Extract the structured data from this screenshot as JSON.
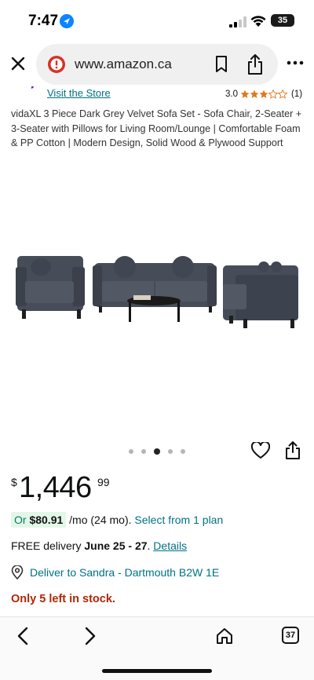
{
  "status_bar": {
    "time": "7:47",
    "battery": "35"
  },
  "browser": {
    "url": "www.amazon.ca",
    "tab_count": "37"
  },
  "store": {
    "link_label": "Visit the Store",
    "rating": "3.0",
    "rating_value": 3,
    "rating_count": "(1)"
  },
  "product": {
    "title": "vidaXL 3 Piece Dark Grey Velvet Sofa Set - Sofa Chair, 2-Seater + 3-Seater with Pillows for Living Room/Lounge | Comfortable Foam & PP Cotton | Modern Design, Solid Wood & Plywood Support",
    "image_count": 5,
    "active_image": 3
  },
  "price": {
    "symbol": "$",
    "whole": "1,446",
    "fraction": "99"
  },
  "financing": {
    "prefix": "Or ",
    "amount": "$80.91",
    "suffix": " /mo (24 mo). ",
    "link": "Select from 1 plan"
  },
  "delivery": {
    "prefix": "FREE delivery ",
    "date": "June 25 - 27",
    "suffix": ". ",
    "link": "Details"
  },
  "deliver_to": {
    "label": "Deliver to Sandra - Dartmouth B2W 1E"
  },
  "stock": {
    "label": "Only 5 left in stock."
  },
  "colors": {
    "link": "#007185",
    "stock": "#b12704",
    "emi_badge": "#e3f7e9",
    "emi_text": "#067d62",
    "star": "#de7921"
  }
}
